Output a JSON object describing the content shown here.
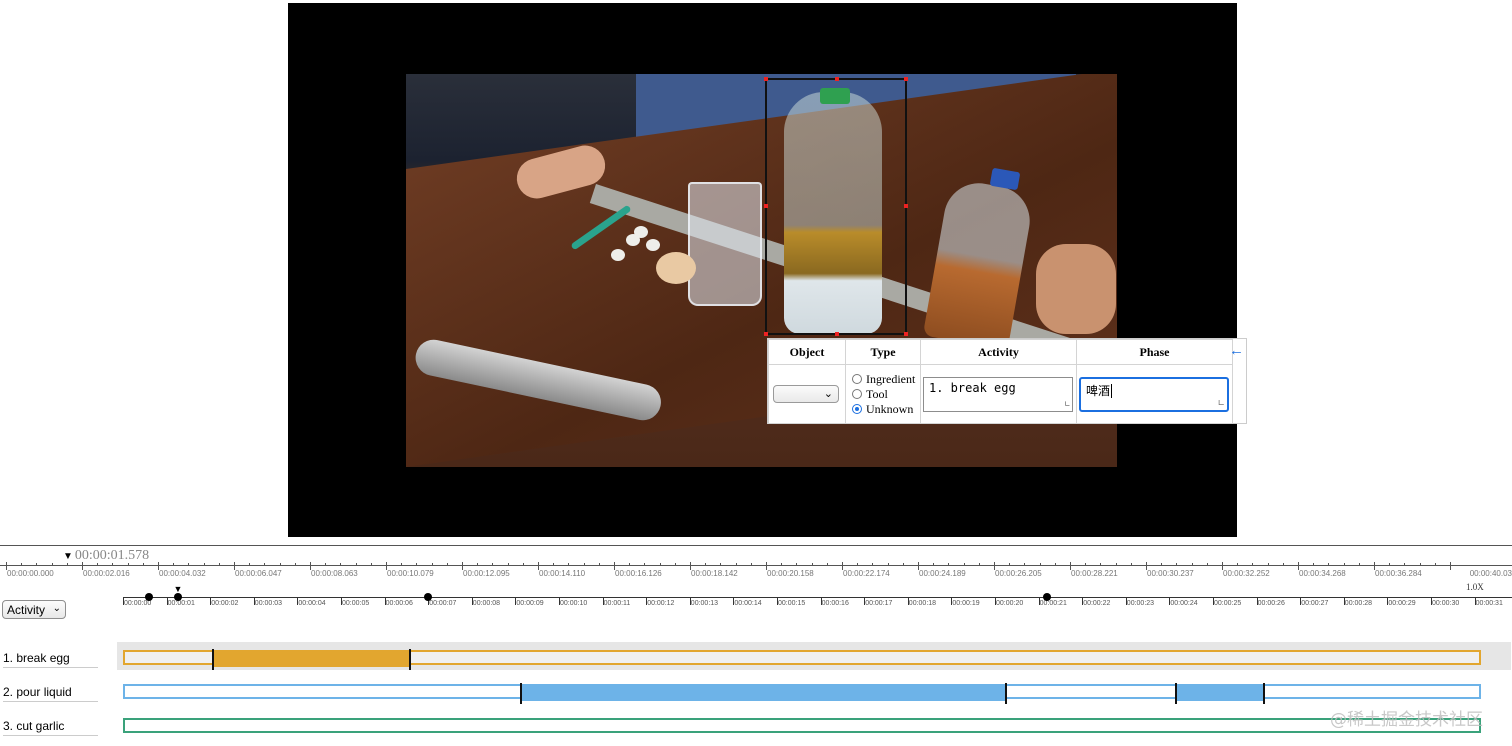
{
  "annotation_panel": {
    "headers": {
      "object": "Object",
      "type": "Type",
      "activity": "Activity",
      "phase": "Phase"
    },
    "object_select_value": "",
    "type_options": [
      {
        "label": "Ingredient",
        "checked": false
      },
      {
        "label": "Tool",
        "checked": false
      },
      {
        "label": "Unknown",
        "checked": true
      }
    ],
    "activity_value": "1. break egg",
    "phase_value": "啤酒",
    "back_icon": "←"
  },
  "timeline": {
    "current_time": "00:00:01.578",
    "speed": "1.0X",
    "overview_ticks": [
      "00:00:00.000",
      "00:00:02.016",
      "00:00:04.032",
      "00:00:06.047",
      "00:00:08.063",
      "00:00:10.079",
      "00:00:12.095",
      "00:00:14.110",
      "00:00:16.126",
      "00:00:18.142",
      "00:00:20.158",
      "00:00:22.174",
      "00:00:24.189",
      "00:00:26.205",
      "00:00:28.221",
      "00:00:30.237",
      "00:00:32.252",
      "00:00:34.268",
      "00:00:36.284",
      "00:00:40.03"
    ],
    "second_ticks": [
      "00:00:00",
      "00:00:01",
      "00:00:02",
      "00:00:03",
      "00:00:04",
      "00:00:05",
      "00:00:06",
      "00:00:07",
      "00:00:08",
      "00:00:09",
      "00:00:10",
      "00:00:11",
      "00:00:12",
      "00:00:13",
      "00:00:14",
      "00:00:15",
      "00:00:16",
      "00:00:17",
      "00:00:18",
      "00:00:19",
      "00:00:20",
      "00:00:21",
      "00:00:22",
      "00:00:23",
      "00:00:24",
      "00:00:25",
      "00:00:26",
      "00:00:27",
      "00:00:28",
      "00:00:29",
      "00:00:30",
      "00:00:31"
    ],
    "keyframe_seconds": [
      0.6,
      1.25,
      7.0,
      21.2
    ],
    "playhead_seconds": 1.25,
    "dropdown_label": "Activity"
  },
  "tracks": [
    {
      "label": "1. break egg",
      "color": "#e2a62f",
      "selected": true,
      "segments_seconds": [
        [
          2.0,
          6.5
        ]
      ]
    },
    {
      "label": "2. pour liquid",
      "color": "#6db3e8",
      "selected": false,
      "segments_seconds": [
        [
          9.05,
          20.1
        ],
        [
          24.0,
          26.0
        ]
      ]
    },
    {
      "label": "3. cut garlic",
      "color": "#3aa27b",
      "selected": false,
      "segments_seconds": []
    }
  ],
  "watermark": "@稀土掘金技术社区"
}
